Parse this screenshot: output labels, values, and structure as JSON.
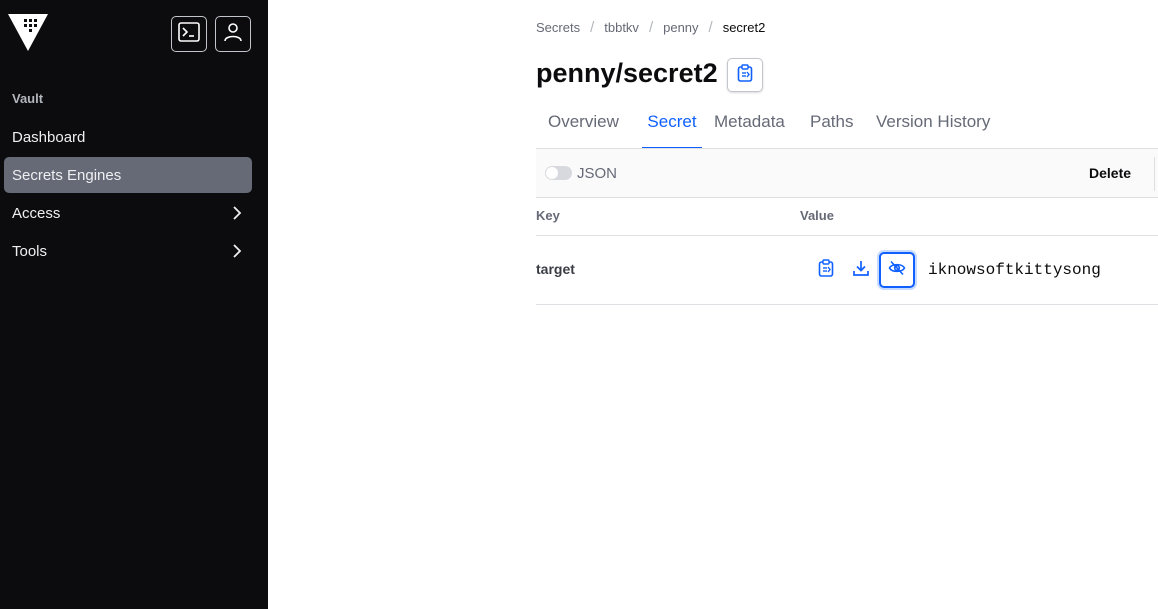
{
  "sidebar": {
    "section_title": "Vault",
    "items": [
      {
        "label": "Dashboard",
        "active": false
      },
      {
        "label": "Secrets Engines",
        "active": true
      },
      {
        "label": "Access",
        "has_children": true
      },
      {
        "label": "Tools",
        "has_children": true
      }
    ]
  },
  "breadcrumb": [
    "Secrets",
    "tbbtkv",
    "penny",
    "secret2"
  ],
  "page_title": "penny/secret2",
  "tabs": [
    "Overview",
    "Secret",
    "Metadata",
    "Paths",
    "Version History"
  ],
  "active_tab": "Secret",
  "toolbar": {
    "json_toggle_label": "JSON",
    "json_toggle_on": false,
    "delete_label": "Delete"
  },
  "table": {
    "headers": {
      "key": "Key",
      "value": "Value"
    },
    "rows": [
      {
        "key": "target",
        "value": "iknowsoftkittysong",
        "masked": false
      }
    ]
  },
  "colors": {
    "sidebar_bg": "#0c0c0e",
    "accent": "#1060ff",
    "active_nav": "#656a76"
  }
}
